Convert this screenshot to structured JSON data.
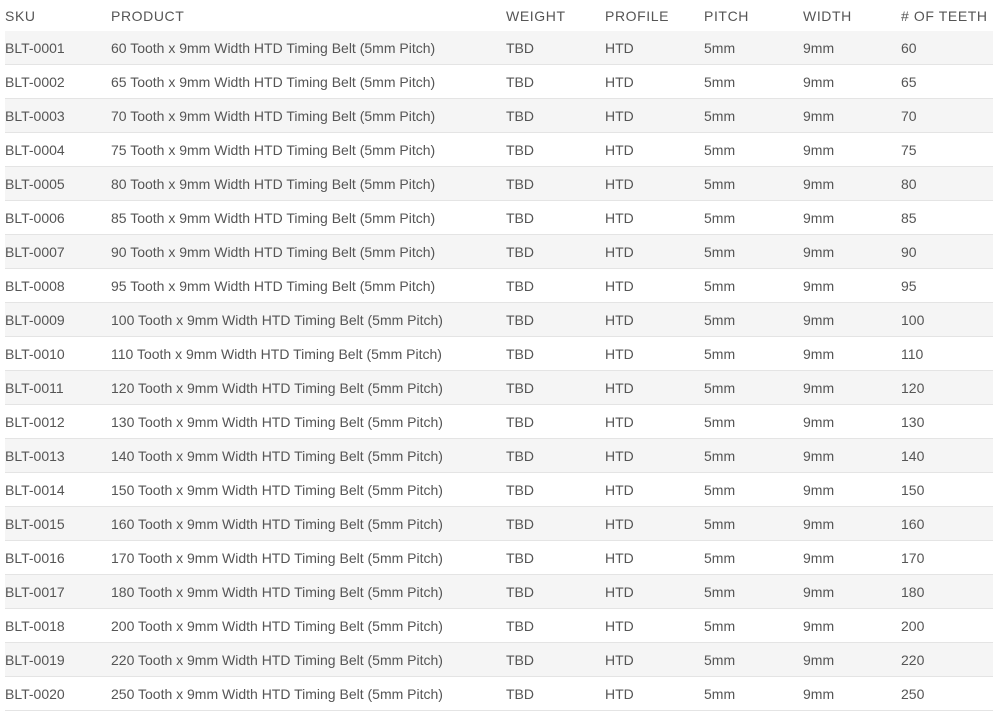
{
  "table": {
    "headers": {
      "sku": "SKU",
      "product": "PRODUCT",
      "weight": "WEIGHT",
      "profile": "PROFILE",
      "pitch": "PITCH",
      "width": "WIDTH",
      "teeth": "# OF TEETH"
    },
    "rows": [
      {
        "sku": "BLT-0001",
        "product": "60 Tooth x 9mm Width HTD Timing Belt (5mm Pitch)",
        "weight": "TBD",
        "profile": "HTD",
        "pitch": "5mm",
        "width": "9mm",
        "teeth": "60"
      },
      {
        "sku": "BLT-0002",
        "product": "65 Tooth x 9mm Width HTD Timing Belt (5mm Pitch)",
        "weight": "TBD",
        "profile": "HTD",
        "pitch": "5mm",
        "width": "9mm",
        "teeth": "65"
      },
      {
        "sku": "BLT-0003",
        "product": "70 Tooth x 9mm Width HTD Timing Belt (5mm Pitch)",
        "weight": "TBD",
        "profile": "HTD",
        "pitch": "5mm",
        "width": "9mm",
        "teeth": "70"
      },
      {
        "sku": "BLT-0004",
        "product": "75 Tooth x 9mm Width HTD Timing Belt (5mm Pitch)",
        "weight": "TBD",
        "profile": "HTD",
        "pitch": "5mm",
        "width": "9mm",
        "teeth": "75"
      },
      {
        "sku": "BLT-0005",
        "product": "80 Tooth x 9mm Width HTD Timing Belt (5mm Pitch)",
        "weight": "TBD",
        "profile": "HTD",
        "pitch": "5mm",
        "width": "9mm",
        "teeth": "80"
      },
      {
        "sku": "BLT-0006",
        "product": "85 Tooth x 9mm Width HTD Timing Belt (5mm Pitch)",
        "weight": "TBD",
        "profile": "HTD",
        "pitch": "5mm",
        "width": "9mm",
        "teeth": "85"
      },
      {
        "sku": "BLT-0007",
        "product": "90 Tooth x 9mm Width HTD Timing Belt (5mm Pitch)",
        "weight": "TBD",
        "profile": "HTD",
        "pitch": "5mm",
        "width": "9mm",
        "teeth": "90"
      },
      {
        "sku": "BLT-0008",
        "product": "95 Tooth x 9mm Width HTD Timing Belt (5mm Pitch)",
        "weight": "TBD",
        "profile": "HTD",
        "pitch": "5mm",
        "width": "9mm",
        "teeth": "95"
      },
      {
        "sku": "BLT-0009",
        "product": "100 Tooth x 9mm Width HTD Timing Belt (5mm Pitch)",
        "weight": "TBD",
        "profile": "HTD",
        "pitch": "5mm",
        "width": "9mm",
        "teeth": "100"
      },
      {
        "sku": "BLT-0010",
        "product": "110 Tooth x 9mm Width HTD Timing Belt (5mm Pitch)",
        "weight": "TBD",
        "profile": "HTD",
        "pitch": "5mm",
        "width": "9mm",
        "teeth": "110"
      },
      {
        "sku": "BLT-0011",
        "product": "120 Tooth x 9mm Width HTD Timing Belt (5mm Pitch)",
        "weight": "TBD",
        "profile": "HTD",
        "pitch": "5mm",
        "width": "9mm",
        "teeth": "120"
      },
      {
        "sku": "BLT-0012",
        "product": "130 Tooth x 9mm Width HTD Timing Belt (5mm Pitch)",
        "weight": "TBD",
        "profile": "HTD",
        "pitch": "5mm",
        "width": "9mm",
        "teeth": "130"
      },
      {
        "sku": "BLT-0013",
        "product": "140 Tooth x 9mm Width HTD Timing Belt (5mm Pitch)",
        "weight": "TBD",
        "profile": "HTD",
        "pitch": "5mm",
        "width": "9mm",
        "teeth": "140"
      },
      {
        "sku": "BLT-0014",
        "product": "150 Tooth x 9mm Width HTD Timing Belt (5mm Pitch)",
        "weight": "TBD",
        "profile": "HTD",
        "pitch": "5mm",
        "width": "9mm",
        "teeth": "150"
      },
      {
        "sku": "BLT-0015",
        "product": "160 Tooth x 9mm Width HTD Timing Belt (5mm Pitch)",
        "weight": "TBD",
        "profile": "HTD",
        "pitch": "5mm",
        "width": "9mm",
        "teeth": "160"
      },
      {
        "sku": "BLT-0016",
        "product": "170 Tooth x 9mm Width HTD Timing Belt (5mm Pitch)",
        "weight": "TBD",
        "profile": "HTD",
        "pitch": "5mm",
        "width": "9mm",
        "teeth": "170"
      },
      {
        "sku": "BLT-0017",
        "product": "180 Tooth x 9mm Width HTD Timing Belt (5mm Pitch)",
        "weight": "TBD",
        "profile": "HTD",
        "pitch": "5mm",
        "width": "9mm",
        "teeth": "180"
      },
      {
        "sku": "BLT-0018",
        "product": "200 Tooth x 9mm Width HTD Timing Belt (5mm Pitch)",
        "weight": "TBD",
        "profile": "HTD",
        "pitch": "5mm",
        "width": "9mm",
        "teeth": "200"
      },
      {
        "sku": "BLT-0019",
        "product": "220 Tooth x 9mm Width HTD Timing Belt (5mm Pitch)",
        "weight": "TBD",
        "profile": "HTD",
        "pitch": "5mm",
        "width": "9mm",
        "teeth": "220"
      },
      {
        "sku": "BLT-0020",
        "product": "250 Tooth x 9mm Width HTD Timing Belt (5mm Pitch)",
        "weight": "TBD",
        "profile": "HTD",
        "pitch": "5mm",
        "width": "9mm",
        "teeth": "250"
      }
    ]
  },
  "colors": {
    "text": "#555555",
    "row_stripe": "#f5f5f5",
    "row_plain": "#ffffff",
    "row_border": "#e4e4e4"
  }
}
